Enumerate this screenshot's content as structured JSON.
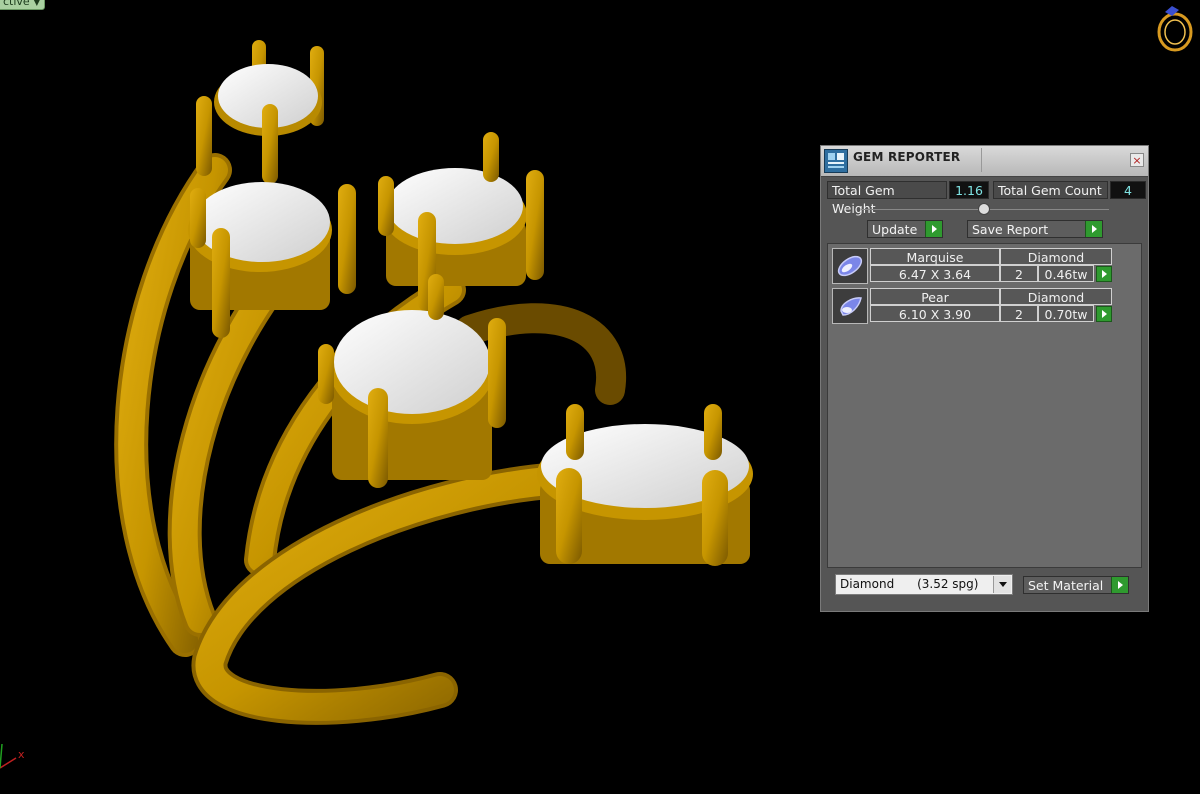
{
  "viewport": {
    "mode_tab": "ctive",
    "axis_label": "x"
  },
  "panel": {
    "title": "GEM REPORTER",
    "close_glyph": "×",
    "total_gem_weight_label": "Total Gem Weight",
    "total_gem_weight_value": "1.16",
    "total_gem_count_label": "Total Gem Count",
    "total_gem_count_value": "4",
    "update_label": "Update",
    "save_report_label": "Save Report",
    "gems": [
      {
        "shape": "Marquise",
        "material": "Diamond",
        "size": "6.47 X 3.64",
        "count": "2",
        "weight": "0.46tw"
      },
      {
        "shape": "Pear",
        "material": "Diamond",
        "size": "6.10 X 3.90",
        "count": "2",
        "weight": "0.70tw"
      }
    ],
    "material_select_value": "Diamond      (3.52 spg)",
    "set_material_label": "Set Material"
  },
  "colors": {
    "gold": "#c69500",
    "gold_dark": "#8a6400",
    "gem": "#f4f4f4",
    "panel_bg": "#555555",
    "accent_green": "#2f9a2f",
    "value_text": "#7fe3e3"
  },
  "icons": {
    "ring_logo": "ring-logo-icon",
    "gem_thumb_marquise": "marquise-gem-icon",
    "gem_thumb_pear": "pear-gem-icon"
  }
}
